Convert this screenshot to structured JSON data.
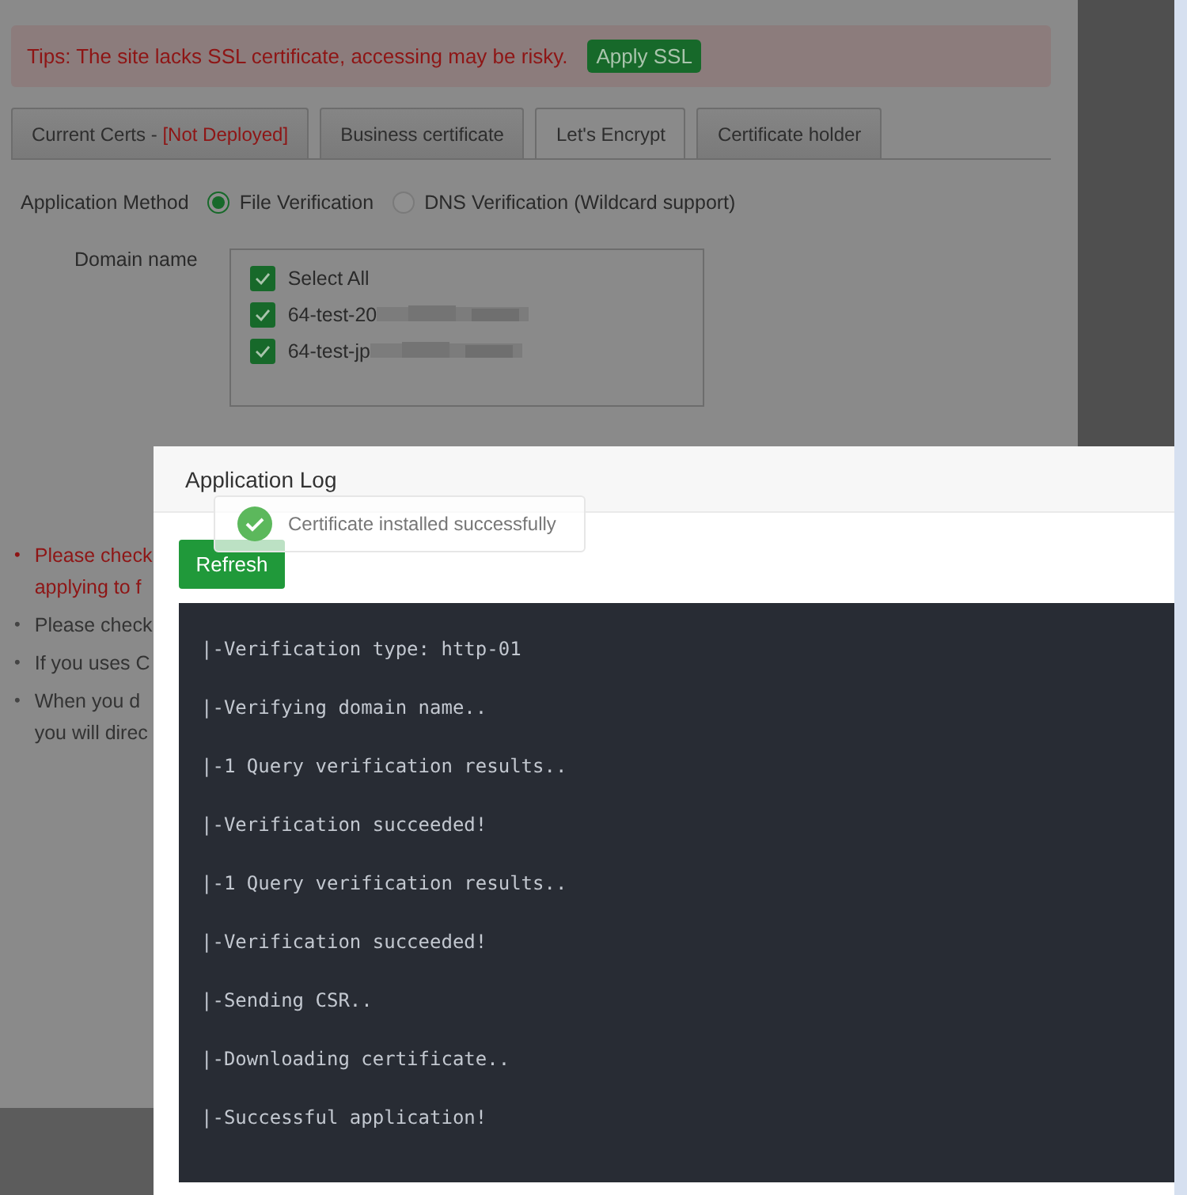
{
  "tip": {
    "text": "Tips: The site lacks SSL certificate, accessing may be risky.",
    "button": "Apply SSL"
  },
  "tabs": [
    {
      "label": "Current Certs - ",
      "status": "[Not Deployed]",
      "selected": false
    },
    {
      "label": "Business certificate",
      "selected": false
    },
    {
      "label": "Let's Encrypt",
      "selected": true
    },
    {
      "label": "Certificate holder",
      "selected": false
    }
  ],
  "method": {
    "label": "Application Method",
    "options": [
      {
        "label": "File Verification",
        "selected": true
      },
      {
        "label": "DNS Verification (Wildcard support)",
        "selected": false
      }
    ]
  },
  "domains": {
    "label": "Domain name",
    "items": [
      {
        "label": "Select All",
        "checked": true,
        "redacted": false
      },
      {
        "label": "64-test-20",
        "checked": true,
        "redacted": true
      },
      {
        "label": "64-test-jp",
        "checked": true,
        "redacted": true
      }
    ]
  },
  "notes": [
    {
      "kind": "warning",
      "marker": "•",
      "lines": [
        "Please check",
        "applying to f"
      ]
    },
    {
      "kind": "note",
      "marker": "•",
      "lines": [
        "Please check"
      ]
    },
    {
      "kind": "note",
      "marker": "•",
      "lines": [
        "If you uses C"
      ]
    },
    {
      "kind": "note",
      "marker": "•",
      "lines": [
        "When you d",
        "you will direc"
      ]
    }
  ],
  "dialog": {
    "title": "Application Log",
    "refresh": "Refresh",
    "log": [
      "|-Verification type: http-01",
      "|-Verifying domain name..",
      "|-1 Query verification results..",
      "|-Verification succeeded!",
      "|-1 Query verification results..",
      "|-Verification succeeded!",
      "|-Sending CSR..",
      "|-Downloading certificate..",
      "|-Successful application!"
    ]
  },
  "toast": {
    "text": "Certificate installed successfully"
  }
}
